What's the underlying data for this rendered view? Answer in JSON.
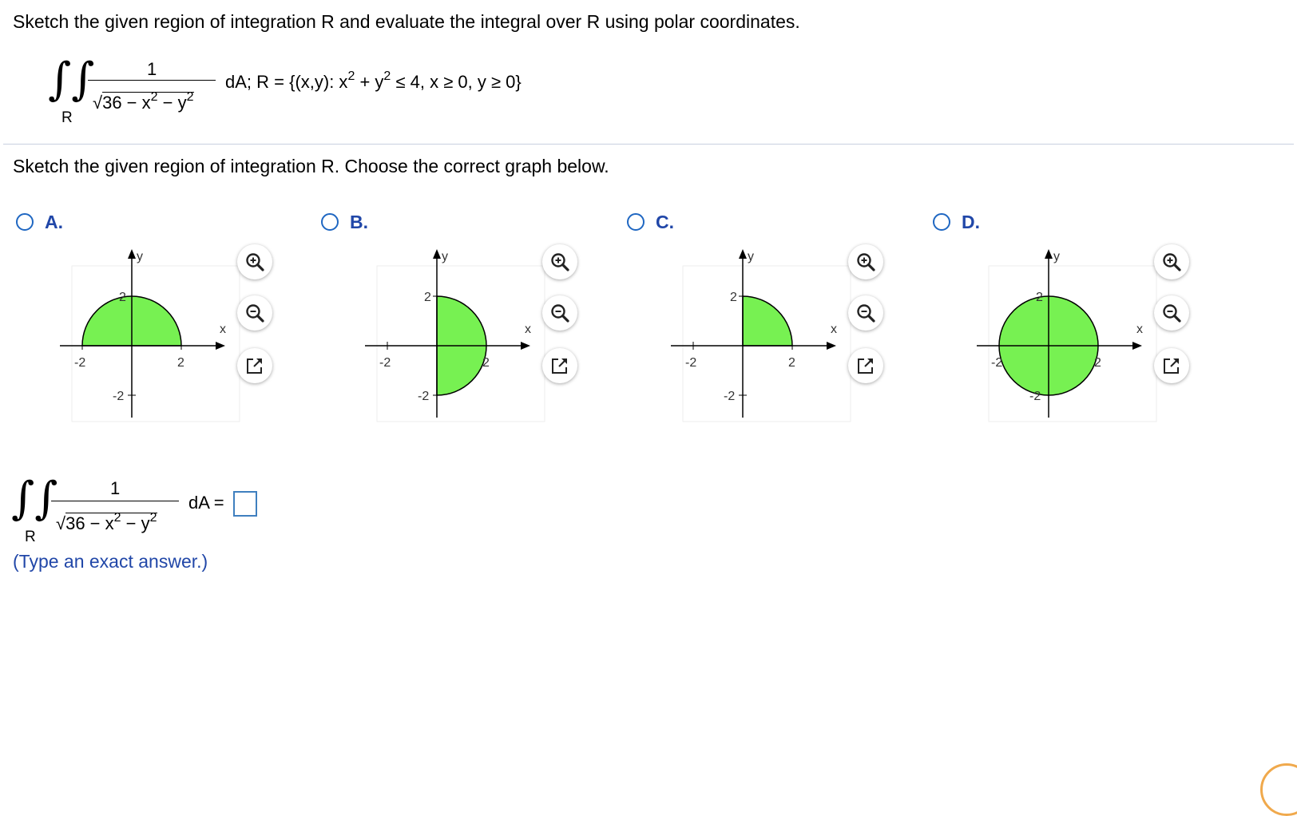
{
  "question": {
    "title": "Sketch the given region of integration R and evaluate the integral over R using polar coordinates.",
    "integral": {
      "numerator": "1",
      "radicand_lead": "36 − x",
      "radicand_mid": " − y",
      "exponent": "2",
      "subscript": "R",
      "dA_region": "dA; R = {(x,y): x",
      "region_mid": " + y",
      "region_tail": " ≤ 4, x ≥ 0, y ≥ 0}"
    }
  },
  "part1": {
    "instruction": "Sketch the given region of integration R. Choose the correct graph below."
  },
  "options": [
    {
      "letter": "A.",
      "region": "upper-half-disk",
      "selected": false
    },
    {
      "letter": "B.",
      "region": "right-half-disk",
      "selected": false
    },
    {
      "letter": "C.",
      "region": "first-quadrant",
      "selected": false
    },
    {
      "letter": "D.",
      "region": "full-disk",
      "selected": false
    }
  ],
  "graph_labels": {
    "x": "x",
    "y": "y",
    "pos": "2",
    "neg": "-2"
  },
  "part2": {
    "numerator": "1",
    "radicand_lead": "36 − x",
    "radicand_mid": " − y",
    "exponent": "2",
    "subscript": "R",
    "dA_eq": "dA =",
    "answer_value": "",
    "hint": "(Type an exact answer.)"
  },
  "tools": {
    "zoom_in": "zoom-in-icon",
    "zoom_out": "zoom-out-icon",
    "popout": "popout-icon"
  },
  "colors": {
    "fill": "#77f152",
    "radio": "#1f67c2",
    "letter": "#2147a8"
  }
}
